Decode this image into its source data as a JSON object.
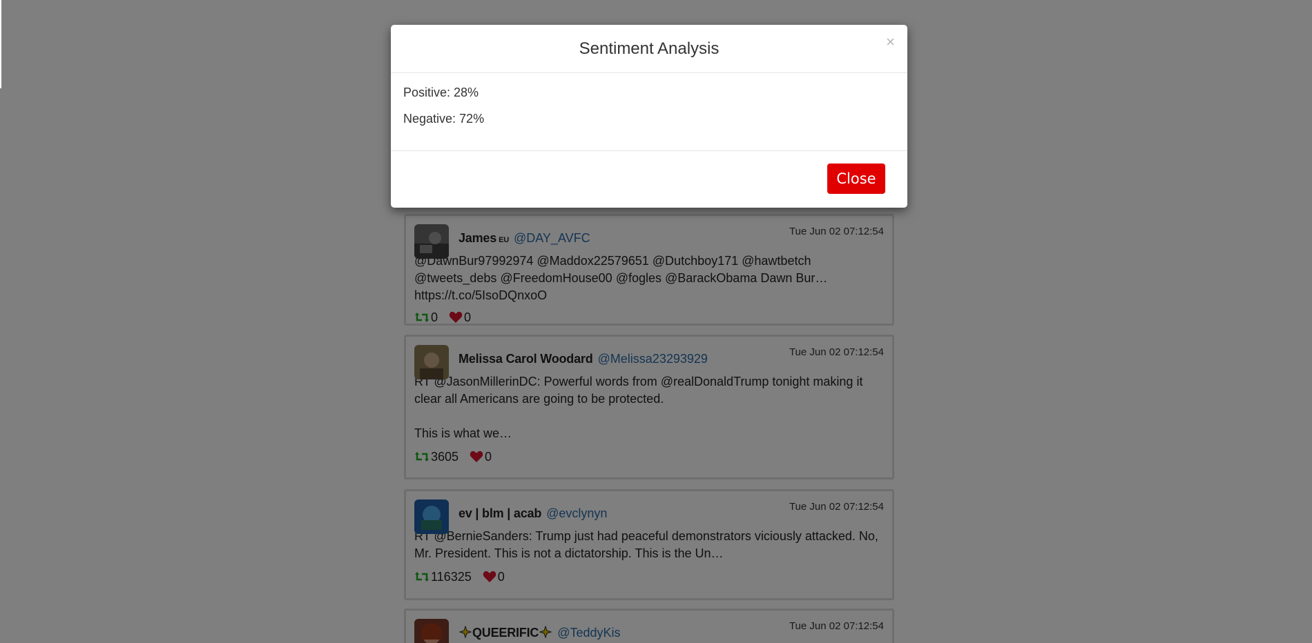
{
  "modal": {
    "title": "Sentiment Analysis",
    "close_x": "×",
    "positive": "Positive: 28%",
    "negative": "Negative: 72%",
    "close_button": "Close"
  },
  "tweets": [
    {
      "name": "James",
      "flag": "EU",
      "handle": "@DAY_AVFC",
      "time": "Tue Jun 02 07:12:54",
      "text": "@DawnBur97992974 @Maddox22579651 @Dutchboy171 @hawtbetch @tweets_debs @FreedomHouse00 @fogles @BarackObama Dawn Bur… https://t.co/5IsoDQnxoO",
      "retweets": "0",
      "likes": "0"
    },
    {
      "name": "Melissa Carol Woodard",
      "flag": "",
      "handle": "@Melissa23293929",
      "time": "Tue Jun 02 07:12:54",
      "text": "RT @JasonMillerinDC: Powerful words from @realDonaldTrump tonight making it clear all Americans are going to be protected.\n\nThis is what we…",
      "retweets": "3605",
      "likes": "0"
    },
    {
      "name": "ev | blm | acab",
      "flag": "",
      "handle": "@evclynyn",
      "time": "Tue Jun 02 07:12:54",
      "text": "RT @BernieSanders: Trump just had peaceful demonstrators viciously attacked.  No, Mr. President. This is not a dictatorship. This is the Un…",
      "retweets": "116325",
      "likes": "0"
    },
    {
      "name": "QUEERIFIC",
      "flag": "",
      "handle": "@TeddyKis",
      "time": "Tue Jun 02 07:12:54",
      "text": "",
      "retweets": "",
      "likes": ""
    }
  ],
  "colors": {
    "retweet": "#19b01e",
    "like": "#d8152f",
    "handle": "#2b6aa6",
    "close_button": "#e00000"
  }
}
